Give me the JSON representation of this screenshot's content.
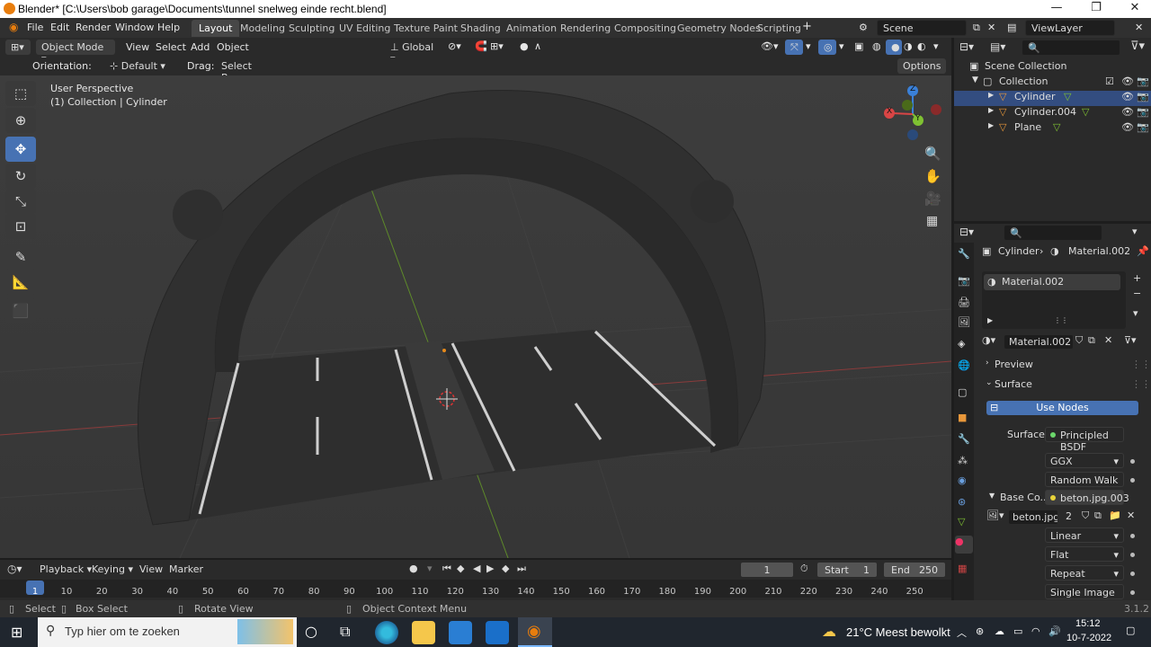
{
  "window": {
    "title": "Blender* [C:\\Users\\bob garage\\Documents\\tunnel snelweg einde recht.blend]"
  },
  "menu": [
    "File",
    "Edit",
    "Render",
    "Window",
    "Help"
  ],
  "workspaces": [
    "Layout",
    "Modeling",
    "Sculpting",
    "UV Editing",
    "Texture Paint",
    "Shading",
    "Animation",
    "Rendering",
    "Compositing",
    "Geometry Nodes",
    "Scripting"
  ],
  "scene": {
    "label": "Scene",
    "view_layer": "ViewLayer"
  },
  "viewport_header": {
    "mode": "Object Mode",
    "view": "View",
    "select": "Select",
    "add": "Add",
    "object": "Object",
    "transform": "Global"
  },
  "tool_settings": {
    "orientation_label": "Orientation:",
    "orientation_value": "Default",
    "drag_label": "Drag:",
    "drag_value": "Select Box",
    "options": "Options"
  },
  "viewport": {
    "perspective": "User Perspective",
    "collection": "(1) Collection | Cylinder"
  },
  "gizmo": {
    "x": "X",
    "y": "Y",
    "z": "Z"
  },
  "outliner": {
    "root": "Scene Collection",
    "collection": "Collection",
    "items": [
      "Cylinder",
      "Cylinder.004",
      "Plane"
    ]
  },
  "properties": {
    "breadcrumb_object": "Cylinder",
    "breadcrumb_material": "Material.002",
    "slot": "Material.002",
    "material_name": "Material.002",
    "preview": "Preview",
    "surface_panel": "Surface",
    "use_nodes": "Use Nodes",
    "surface_label": "Surface",
    "surface_value": "Principled BSDF",
    "distribution": "GGX",
    "subsurface": "Random Walk",
    "base_color_label": "Base Co...",
    "base_color_value": "beton.jpg.003",
    "image_name": "beton.jpg....",
    "image_users": "2",
    "interpolation": "Linear",
    "projection": "Flat",
    "extension": "Repeat",
    "source": "Single Image"
  },
  "timeline": {
    "playback": "Playback",
    "keying": "Keying",
    "view": "View",
    "marker": "Marker",
    "current_frame": "1",
    "start_label": "Start",
    "start": "1",
    "end_label": "End",
    "end": "250",
    "ticks": [
      "1",
      "10",
      "20",
      "30",
      "40",
      "50",
      "60",
      "70",
      "80",
      "90",
      "100",
      "110",
      "120",
      "130",
      "140",
      "150",
      "160",
      "170",
      "180",
      "190",
      "200",
      "210",
      "220",
      "230",
      "240",
      "250"
    ]
  },
  "status": {
    "select": "Select",
    "box_select": "Box Select",
    "rotate_view": "Rotate View",
    "context_menu": "Object Context Menu",
    "version": "3.1.2"
  },
  "taskbar": {
    "search_placeholder": "Typ hier om te zoeken",
    "weather": "21°C  Meest bewolkt",
    "time": "15:12",
    "date": "10-7-2022"
  },
  "colors": {
    "accent": "#4772b3",
    "blender_orange": "#e87d0d",
    "x_axis": "#d94545",
    "y_axis": "#7fc132",
    "z_axis": "#3a80d8"
  }
}
